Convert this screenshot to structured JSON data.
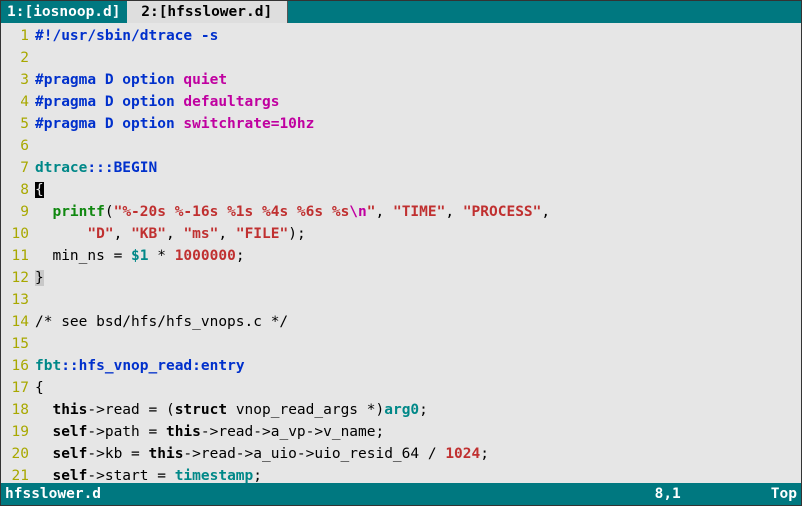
{
  "tabs": [
    {
      "label": "1:[iosnoop.d]",
      "active": false
    },
    {
      "label": " 2:[hfsslower.d] ",
      "active": true
    }
  ],
  "status": {
    "file": "hfsslower.d",
    "pos": "8,1",
    "scroll": "Top"
  },
  "lines": [
    {
      "n": "1",
      "segments": [
        {
          "t": "#!/usr/sbin/dtrace -s",
          "cls": "c-blue"
        }
      ]
    },
    {
      "n": "2",
      "segments": []
    },
    {
      "n": "3",
      "segments": [
        {
          "t": "#pragma D option ",
          "cls": "c-blue"
        },
        {
          "t": "quiet",
          "cls": "c-mag"
        }
      ]
    },
    {
      "n": "4",
      "segments": [
        {
          "t": "#pragma D option ",
          "cls": "c-blue"
        },
        {
          "t": "defaultargs",
          "cls": "c-mag"
        }
      ]
    },
    {
      "n": "5",
      "segments": [
        {
          "t": "#pragma D option ",
          "cls": "c-blue"
        },
        {
          "t": "switchrate=",
          "cls": "c-mag"
        },
        {
          "t": "10hz",
          "cls": "c-mag"
        }
      ]
    },
    {
      "n": "6",
      "segments": []
    },
    {
      "n": "7",
      "segments": [
        {
          "t": "dtrace",
          "cls": "c-teal"
        },
        {
          "t": ":::BEGIN",
          "cls": "c-blue"
        }
      ]
    },
    {
      "n": "8",
      "cursor": true,
      "segments": [
        {
          "t": "{",
          "cls": "cursor"
        }
      ]
    },
    {
      "n": "9",
      "segments": [
        {
          "t": "  "
        },
        {
          "t": "printf",
          "cls": "c-green"
        },
        {
          "t": "("
        },
        {
          "t": "\"%-20s %-16s %1s %4s %6s %s",
          "cls": "c-red"
        },
        {
          "t": "\\n",
          "cls": "c-mag"
        },
        {
          "t": "\"",
          "cls": "c-red"
        },
        {
          "t": ", "
        },
        {
          "t": "\"TIME\"",
          "cls": "c-red"
        },
        {
          "t": ", "
        },
        {
          "t": "\"PROCESS\"",
          "cls": "c-red"
        },
        {
          "t": ","
        }
      ]
    },
    {
      "n": "10",
      "segments": [
        {
          "t": "      "
        },
        {
          "t": "\"D\"",
          "cls": "c-red"
        },
        {
          "t": ", "
        },
        {
          "t": "\"KB\"",
          "cls": "c-red"
        },
        {
          "t": ", "
        },
        {
          "t": "\"ms\"",
          "cls": "c-red"
        },
        {
          "t": ", "
        },
        {
          "t": "\"FILE\"",
          "cls": "c-red"
        },
        {
          "t": ");"
        }
      ]
    },
    {
      "n": "11",
      "segments": [
        {
          "t": "  min_ns = "
        },
        {
          "t": "$1",
          "cls": "c-teal"
        },
        {
          "t": " * "
        },
        {
          "t": "1000000",
          "cls": "c-red"
        },
        {
          "t": ";"
        }
      ]
    },
    {
      "n": "12",
      "segments": [
        {
          "t": "}",
          "cls": ""
        }
      ],
      "matchbrace": true
    },
    {
      "n": "13",
      "segments": []
    },
    {
      "n": "14",
      "segments": [
        {
          "t": "/* see bsd/hfs/hfs_vnops.c */",
          "cls": ""
        }
      ]
    },
    {
      "n": "15",
      "segments": []
    },
    {
      "n": "16",
      "segments": [
        {
          "t": "fbt",
          "cls": "c-teal"
        },
        {
          "t": "::",
          "cls": "c-blue"
        },
        {
          "t": "hfs_vnop_read",
          "cls": "c-blue"
        },
        {
          "t": ":entry",
          "cls": "c-blue"
        }
      ]
    },
    {
      "n": "17",
      "segments": [
        {
          "t": "{"
        }
      ]
    },
    {
      "n": "18",
      "segments": [
        {
          "t": "  "
        },
        {
          "t": "this",
          "cls": "c-bold"
        },
        {
          "t": "->read = ("
        },
        {
          "t": "struct",
          "cls": "c-bold"
        },
        {
          "t": " vnop_read_args *)"
        },
        {
          "t": "arg0",
          "cls": "c-teal"
        },
        {
          "t": ";"
        }
      ]
    },
    {
      "n": "19",
      "segments": [
        {
          "t": "  "
        },
        {
          "t": "self",
          "cls": "c-bold"
        },
        {
          "t": "->path = "
        },
        {
          "t": "this",
          "cls": "c-bold"
        },
        {
          "t": "->read->a_vp->v_name;"
        }
      ]
    },
    {
      "n": "20",
      "segments": [
        {
          "t": "  "
        },
        {
          "t": "self",
          "cls": "c-bold"
        },
        {
          "t": "->kb = "
        },
        {
          "t": "this",
          "cls": "c-bold"
        },
        {
          "t": "->read->a_uio->uio_resid_64 / "
        },
        {
          "t": "1024",
          "cls": "c-red"
        },
        {
          "t": ";"
        }
      ]
    },
    {
      "n": "21",
      "segments": [
        {
          "t": "  "
        },
        {
          "t": "self",
          "cls": "c-bold"
        },
        {
          "t": "->start = "
        },
        {
          "t": "timestamp",
          "cls": "c-teal"
        },
        {
          "t": ";"
        }
      ]
    }
  ]
}
